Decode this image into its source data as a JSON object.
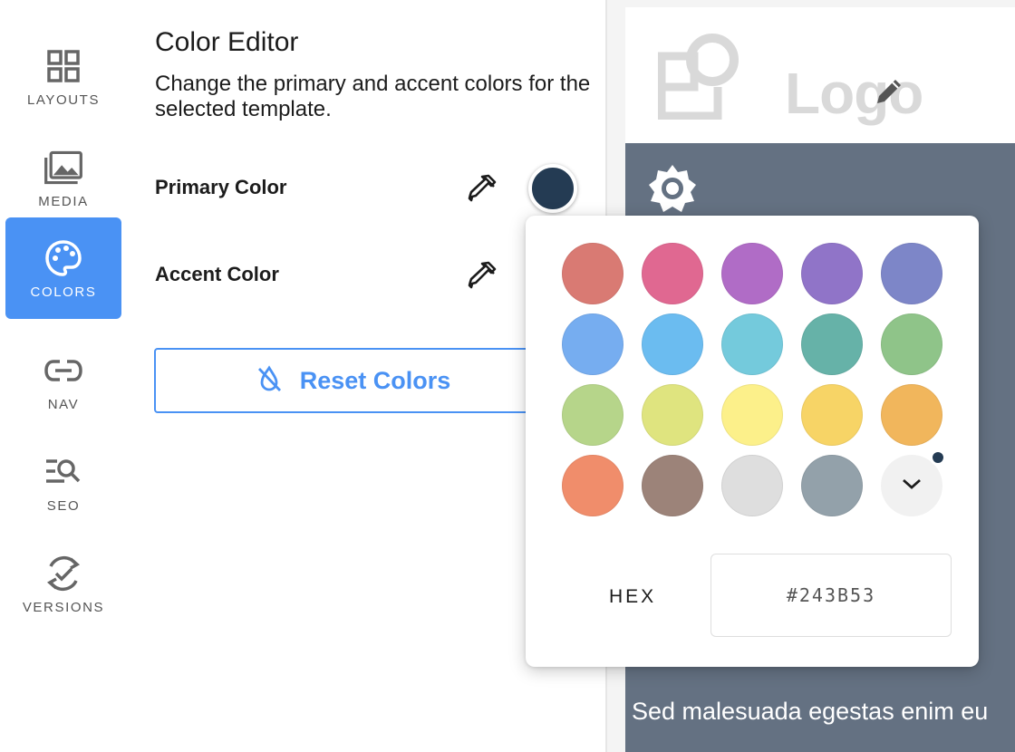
{
  "sidebar": {
    "items": [
      {
        "label": "LAYOUTS",
        "icon": "layouts-grid-icon",
        "active": false
      },
      {
        "label": "MEDIA",
        "icon": "media-images-icon",
        "active": false
      },
      {
        "label": "COLORS",
        "icon": "palette-icon",
        "active": true
      },
      {
        "label": "NAV",
        "icon": "link-icon",
        "active": false
      },
      {
        "label": "SEO",
        "icon": "seo-search-icon",
        "active": false
      },
      {
        "label": "VERSIONS",
        "icon": "versions-sync-check-icon",
        "active": false
      }
    ]
  },
  "editor": {
    "title": "Color Editor",
    "description": "Change the primary and accent colors for the selected template.",
    "primary_label": "Primary Color",
    "accent_label": "Accent Color",
    "primary_value": "#243B53",
    "reset_label": "Reset Colors"
  },
  "preview": {
    "logo_text": "Logo",
    "body_text": "Sed malesuada egestas enim eu",
    "body_color": "#647182"
  },
  "popover": {
    "palette": [
      "#d97a73",
      "#e06891",
      "#b06cc6",
      "#9074c8",
      "#7d86c8",
      "#76adf0",
      "#6bbcf0",
      "#74cadc",
      "#66b2a8",
      "#8fc489",
      "#b6d58a",
      "#dfe47f",
      "#fcf08a",
      "#f7d466",
      "#f1b65c",
      "#f08d6b",
      "#9c8379",
      "#dedede",
      "#93a1aa"
    ],
    "hex_label": "HEX",
    "hex_value": "#243B53"
  },
  "colors": {
    "accent": "#4a92f4",
    "primary": "#243B53"
  }
}
